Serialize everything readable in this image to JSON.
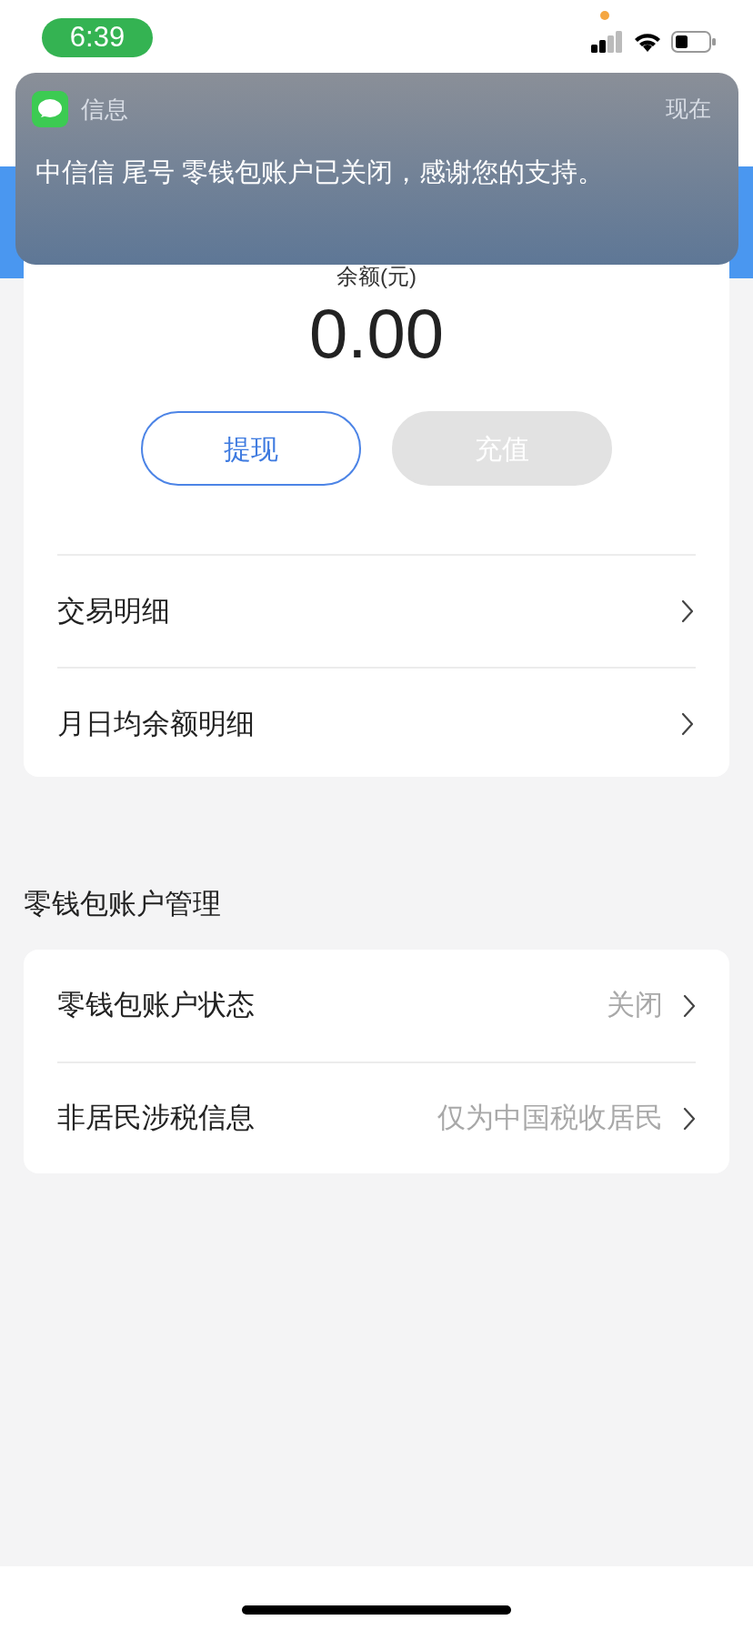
{
  "status_bar": {
    "time": "6:39"
  },
  "notification": {
    "app": "信息",
    "time": "现在",
    "message": "中信信 尾号 零钱包账户已关闭，感谢您的支持。"
  },
  "balance": {
    "label": "余额(元)",
    "amount": "0.00"
  },
  "actions": [
    {
      "label": "提现",
      "disabled": false
    },
    {
      "label": "充值",
      "disabled": true
    }
  ],
  "detail_rows": [
    {
      "label": "交易明细"
    },
    {
      "label": "月日均余额明细"
    }
  ],
  "management": {
    "title": "零钱包账户管理",
    "rows": [
      {
        "label": "零钱包账户状态",
        "value": "关闭"
      },
      {
        "label": "非居民涉税信息",
        "value": "仅为中国税收居民"
      }
    ]
  }
}
